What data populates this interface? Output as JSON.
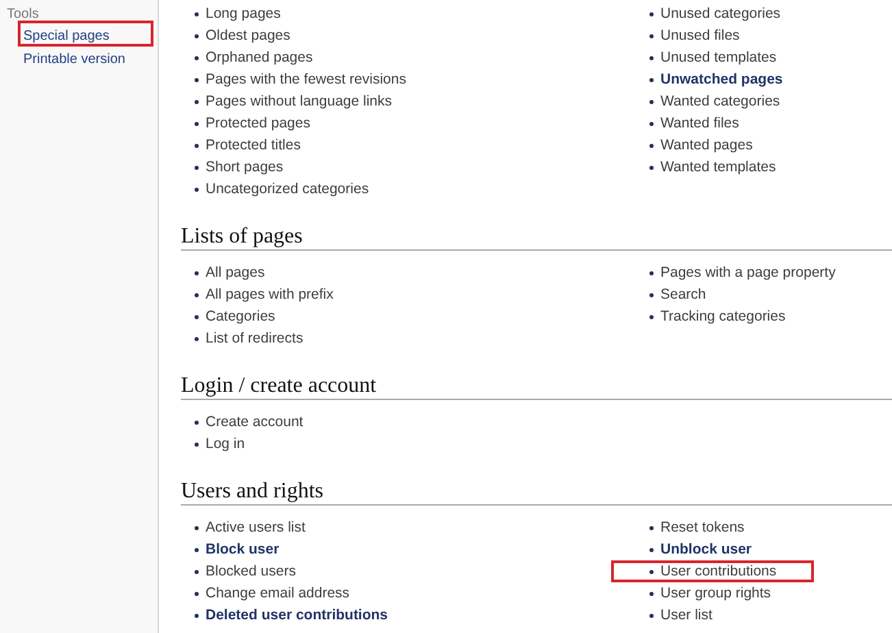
{
  "sidebar": {
    "heading": "Tools",
    "items": [
      {
        "label": "Special pages",
        "highlighted": true
      },
      {
        "label": "Printable version",
        "highlighted": false
      }
    ]
  },
  "sections": [
    {
      "left": [
        {
          "label": "Long pages",
          "restricted": false,
          "highlighted": false
        },
        {
          "label": "Oldest pages",
          "restricted": false,
          "highlighted": false
        },
        {
          "label": "Orphaned pages",
          "restricted": false,
          "highlighted": false
        },
        {
          "label": "Pages with the fewest revisions",
          "restricted": false,
          "highlighted": false
        },
        {
          "label": "Pages without language links",
          "restricted": false,
          "highlighted": false
        },
        {
          "label": "Protected pages",
          "restricted": false,
          "highlighted": false
        },
        {
          "label": "Protected titles",
          "restricted": false,
          "highlighted": false
        },
        {
          "label": "Short pages",
          "restricted": false,
          "highlighted": false
        },
        {
          "label": "Uncategorized categories",
          "restricted": false,
          "highlighted": false
        }
      ],
      "right": [
        {
          "label": "Unused categories",
          "restricted": false,
          "highlighted": false
        },
        {
          "label": "Unused files",
          "restricted": false,
          "highlighted": false
        },
        {
          "label": "Unused templates",
          "restricted": false,
          "highlighted": false
        },
        {
          "label": "Unwatched pages",
          "restricted": true,
          "highlighted": false
        },
        {
          "label": "Wanted categories",
          "restricted": false,
          "highlighted": false
        },
        {
          "label": "Wanted files",
          "restricted": false,
          "highlighted": false
        },
        {
          "label": "Wanted pages",
          "restricted": false,
          "highlighted": false
        },
        {
          "label": "Wanted templates",
          "restricted": false,
          "highlighted": false
        }
      ]
    },
    {
      "heading": "Lists of pages",
      "left": [
        {
          "label": "All pages",
          "restricted": false,
          "highlighted": false
        },
        {
          "label": "All pages with prefix",
          "restricted": false,
          "highlighted": false
        },
        {
          "label": "Categories",
          "restricted": false,
          "highlighted": false
        },
        {
          "label": "List of redirects",
          "restricted": false,
          "highlighted": false
        }
      ],
      "right": [
        {
          "label": "Pages with a page property",
          "restricted": false,
          "highlighted": false
        },
        {
          "label": "Search",
          "restricted": false,
          "highlighted": false
        },
        {
          "label": "Tracking categories",
          "restricted": false,
          "highlighted": false
        }
      ]
    },
    {
      "heading": "Login / create account",
      "left": [
        {
          "label": "Create account",
          "restricted": false,
          "highlighted": false
        },
        {
          "label": "Log in",
          "restricted": false,
          "highlighted": false
        }
      ]
    },
    {
      "heading": "Users and rights",
      "left": [
        {
          "label": "Active users list",
          "restricted": false,
          "highlighted": false
        },
        {
          "label": "Block user",
          "restricted": true,
          "highlighted": false
        },
        {
          "label": "Blocked users",
          "restricted": false,
          "highlighted": false
        },
        {
          "label": "Change email address",
          "restricted": false,
          "highlighted": false
        },
        {
          "label": "Deleted user contributions",
          "restricted": true,
          "highlighted": false
        }
      ],
      "right": [
        {
          "label": "Reset tokens",
          "restricted": false,
          "highlighted": false
        },
        {
          "label": "Unblock user",
          "restricted": true,
          "highlighted": false
        },
        {
          "label": "User contributions",
          "restricted": false,
          "highlighted": true
        },
        {
          "label": "User group rights",
          "restricted": false,
          "highlighted": false
        },
        {
          "label": "User list",
          "restricted": false,
          "highlighted": false
        }
      ]
    }
  ]
}
